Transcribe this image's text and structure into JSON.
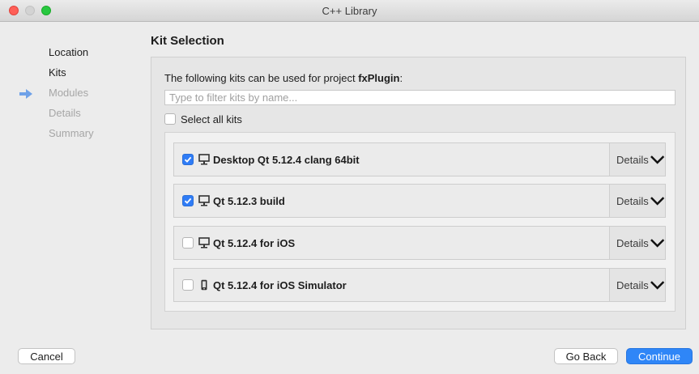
{
  "window": {
    "title": "C++ Library"
  },
  "sidebar": {
    "steps": [
      {
        "label": "Location",
        "state": "done"
      },
      {
        "label": "Kits",
        "state": "active"
      },
      {
        "label": "Modules",
        "state": "pending"
      },
      {
        "label": "Details",
        "state": "pending"
      },
      {
        "label": "Summary",
        "state": "pending"
      }
    ],
    "current_step_icon": "arrow-right-icon"
  },
  "main": {
    "title": "Kit Selection",
    "intro_prefix": "The following kits can be used for project ",
    "project_name": "fxPlugin",
    "intro_suffix": ":",
    "filter": {
      "placeholder": "Type to filter kits by name...",
      "value": ""
    },
    "select_all": {
      "label": "Select all kits",
      "checked": false
    },
    "kits": [
      {
        "name": "Desktop Qt 5.12.4 clang 64bit",
        "checked": true,
        "icon": "desktop-icon",
        "details_label": "Details"
      },
      {
        "name": "Qt 5.12.3 build",
        "checked": true,
        "icon": "desktop-icon",
        "details_label": "Details"
      },
      {
        "name": "Qt 5.12.4 for iOS",
        "checked": false,
        "icon": "desktop-icon",
        "details_label": "Details"
      },
      {
        "name": "Qt 5.12.4 for iOS Simulator",
        "checked": false,
        "icon": "mobile-device-icon",
        "details_label": "Details"
      }
    ]
  },
  "footer": {
    "cancel_label": "Cancel",
    "back_label": "Go Back",
    "continue_label": "Continue"
  },
  "colors": {
    "accent": "#2f86f7",
    "checkbox_checked": "#2f7cf6",
    "close": "#ff5f57",
    "maximize": "#28c840"
  }
}
